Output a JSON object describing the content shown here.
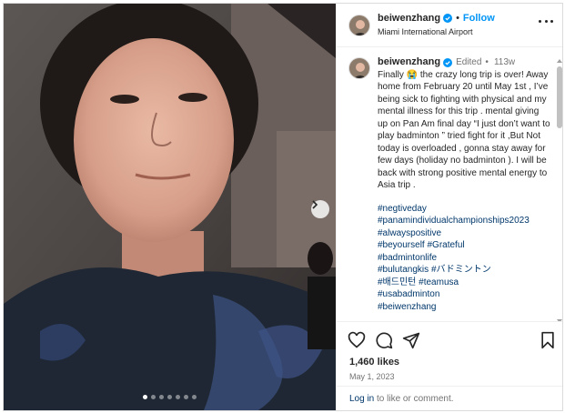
{
  "post": {
    "username": "beiwenzhang",
    "follow_label": "Follow",
    "separator": "•",
    "location": "Miami International Airport",
    "caption": {
      "edited_label": "Edited",
      "dot": "•",
      "time_ago": "113w",
      "text": "Finally 😭 the crazy long trip is over! Away home from February 20 until May 1st , I’ve being sick to fighting with physical and my mental illness for this trip . mental giving up on Pan Am final day “I just don’t want to play badminton ” tried fight for it ,But Not today is overloaded , gonna stay away for few days (holiday no badminton ). I will be back with strong positive mental energy to Asia trip .",
      "hashtags": [
        "#negtiveday",
        "#panamindividualchampionships2023",
        "#alwayspositive",
        "#beyourself",
        "#Grateful",
        "#badmintonlife",
        "#bulutangkis",
        "#バドミントン",
        "#배드민턴",
        "#teamusa",
        "#usabadminton",
        "#beiwenzhang"
      ]
    },
    "likes": "1,460 likes",
    "date": "May 1, 2023",
    "login_link": "Log in",
    "login_suffix": " to like or comment.",
    "carousel": {
      "total": 7,
      "active_index": 0
    }
  },
  "icons": {
    "verified": "verified-badge-icon",
    "more": "more-options-icon",
    "like": "heart-icon",
    "comment": "comment-icon",
    "share": "share-icon",
    "save": "bookmark-icon",
    "next": "chevron-right-icon"
  },
  "colors": {
    "accent": "#0095f6",
    "link": "#00376b",
    "text": "#262626",
    "muted": "#737373"
  }
}
